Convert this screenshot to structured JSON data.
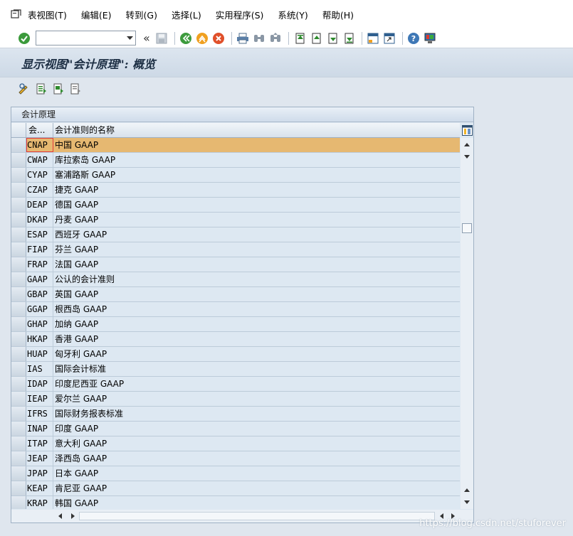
{
  "menubar": {
    "items": [
      "表视图(T)",
      "编辑(E)",
      "转到(G)",
      "选择(L)",
      "实用程序(S)",
      "系统(Y)",
      "帮助(H)"
    ]
  },
  "toolbar": {
    "command_field_value": "",
    "back_glyph": "«"
  },
  "title": "显示视图\"会计原理\": 概览",
  "panel": {
    "title": "会计原理",
    "columns": {
      "code": "会...",
      "name": "会计准则的名称"
    }
  },
  "rows": [
    {
      "code": "CNAP",
      "name": "中国 GAAP",
      "selected": true
    },
    {
      "code": "CWAP",
      "name": "库拉索岛 GAAP"
    },
    {
      "code": "CYAP",
      "name": "塞浦路斯 GAAP"
    },
    {
      "code": "CZAP",
      "name": "捷克 GAAP"
    },
    {
      "code": "DEAP",
      "name": "德国 GAAP"
    },
    {
      "code": "DKAP",
      "name": "丹麦 GAAP"
    },
    {
      "code": "ESAP",
      "name": "西班牙 GAAP"
    },
    {
      "code": "FIAP",
      "name": "芬兰 GAAP"
    },
    {
      "code": "FRAP",
      "name": "法国 GAAP"
    },
    {
      "code": "GAAP",
      "name": "公认的会计准则"
    },
    {
      "code": "GBAP",
      "name": "英国 GAAP"
    },
    {
      "code": "GGAP",
      "name": "根西岛 GAAP"
    },
    {
      "code": "GHAP",
      "name": "加纳 GAAP"
    },
    {
      "code": "HKAP",
      "name": "香港 GAAP"
    },
    {
      "code": "HUAP",
      "name": "匈牙利 GAAP"
    },
    {
      "code": "IAS",
      "name": "国际会计标准"
    },
    {
      "code": "IDAP",
      "name": "印度尼西亚 GAAP"
    },
    {
      "code": "IEAP",
      "name": "爱尔兰 GAAP"
    },
    {
      "code": "IFRS",
      "name": "国际财务报表标准"
    },
    {
      "code": "INAP",
      "name": "印度 GAAP"
    },
    {
      "code": "ITAP",
      "name": "意大利 GAAP"
    },
    {
      "code": "JEAP",
      "name": "泽西岛 GAAP"
    },
    {
      "code": "JPAP",
      "name": "日本 GAAP"
    },
    {
      "code": "KEAP",
      "name": "肯尼亚 GAAP"
    },
    {
      "code": "KRAP",
      "name": "韩国 GAAP"
    }
  ],
  "watermark": "https://blog.csdn.net/stuforever",
  "colors": {
    "selected_row": "#e6b871",
    "row_bg": "#dde8f2",
    "background": "#dfe6ee"
  }
}
